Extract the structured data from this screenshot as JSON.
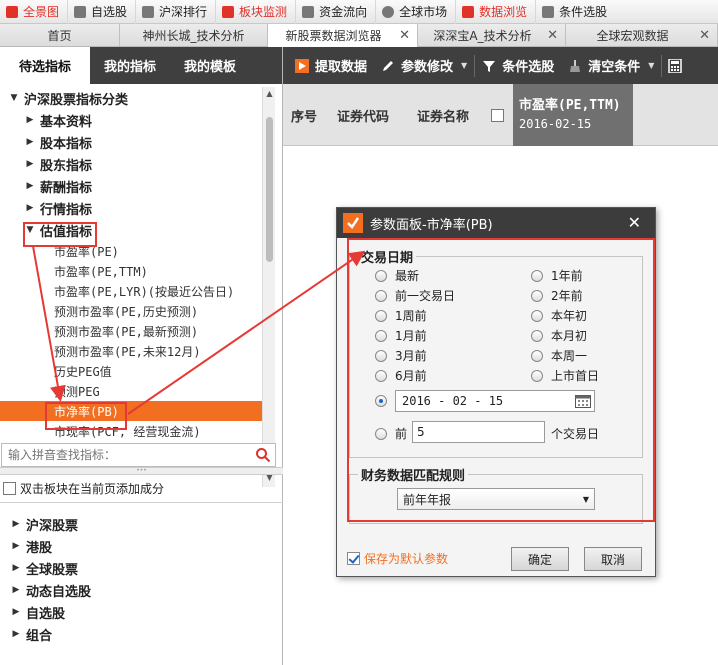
{
  "menubar": {
    "items": [
      {
        "label": "全景图",
        "icon": "panorama-icon",
        "color": "#e0312a",
        "active": true
      },
      {
        "label": "自选股",
        "icon": "star-list-icon",
        "color": "#555555",
        "active": false
      },
      {
        "label": "沪深排行",
        "icon": "ranking-icon",
        "color": "#555555",
        "active": false
      },
      {
        "label": "板块监测",
        "icon": "sector-monitor-icon",
        "color": "#e0312a",
        "active": true
      },
      {
        "label": "资金流向",
        "icon": "fund-flow-icon",
        "color": "#555555",
        "active": false
      },
      {
        "label": "全球市场",
        "icon": "globe-icon",
        "color": "#555555",
        "active": false
      },
      {
        "label": "数据浏览",
        "icon": "data-browse-icon",
        "color": "#e0312a",
        "active": true
      },
      {
        "label": "条件选股",
        "icon": "filter-stock-icon",
        "color": "#555555",
        "active": false
      }
    ]
  },
  "tabs": [
    {
      "label": "首页",
      "closable": false,
      "active": false
    },
    {
      "label": "神州长城_技术分析",
      "closable": false,
      "active": false
    },
    {
      "label": "新股票数据浏览器",
      "closable": true,
      "active": true
    },
    {
      "label": "深深宝A_技术分析",
      "closable": true,
      "active": false
    },
    {
      "label": "全球宏观数据",
      "closable": true,
      "active": false
    }
  ],
  "left_panel": {
    "tabs": [
      "待选指标",
      "我的指标",
      "我的模板"
    ],
    "tree_root": "沪深股票指标分类",
    "categories": [
      "基本资料",
      "股本指标",
      "股东指标",
      "薪酬指标",
      "行情指标"
    ],
    "expanded_category": "估值指标",
    "leaves": [
      "市盈率(PE)",
      "市盈率(PE,TTM)",
      "市盈率(PE,LYR)(按最近公告日)",
      "预测市盈率(PE,历史预测)",
      "预测市盈率(PE,最新预测)",
      "预测市盈率(PE,未来12月)",
      "历史PEG值",
      "预测PEG",
      "市净率(PB)",
      "市现率(PCF, 经营现金流)"
    ],
    "selected_leaf": "市净率(PB)",
    "search_placeholder": "输入拼音查找指标：",
    "add_to_page_label": "双击板块在当前页添加成分",
    "groups": [
      "沪深股票",
      "港股",
      "全球股票",
      "动态自选股",
      "自选股",
      "组合"
    ]
  },
  "toolbar": {
    "fetch_label": "提取数据",
    "params_label": "参数修改",
    "filter_label": "条件选股",
    "clear_label": "清空条件"
  },
  "grid": {
    "headers": [
      "序号",
      "证券代码",
      "证券名称"
    ],
    "selected_column_title": "市盈率(PE,TTM)",
    "selected_column_date": "2016-02-15"
  },
  "dialog": {
    "title": "参数面板-市净率(PB)",
    "trade_date_legend": "交易日期",
    "options_left": [
      "最新",
      "前一交易日",
      "1周前",
      "1月前",
      "3月前",
      "6月前"
    ],
    "options_right": [
      "1年前",
      "2年前",
      "本年初",
      "本月初",
      "本周一",
      "上市首日"
    ],
    "date_value": "2016 - 02 - 15",
    "prev_label": "前",
    "prev_value": "5",
    "prev_suffix": "个交易日",
    "finance_legend": "财务数据匹配规则",
    "finance_value": "前年年报",
    "save_default_label": "保存为默认参数",
    "ok_label": "确定",
    "cancel_label": "取消"
  },
  "colors": {
    "accent": "#f26f21",
    "annotation": "#e53935",
    "dark_bar": "#3f3f3f"
  }
}
